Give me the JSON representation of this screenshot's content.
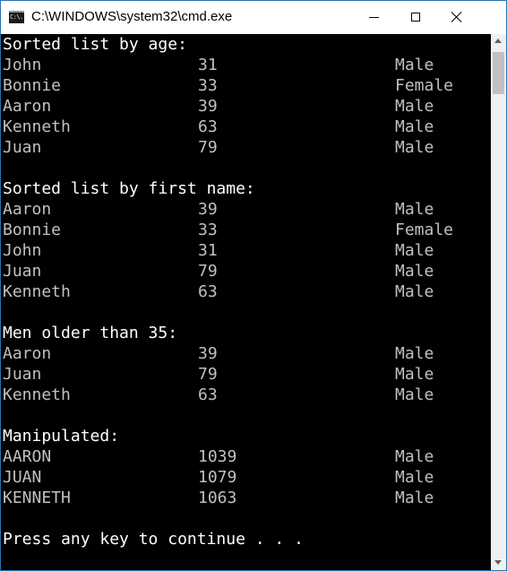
{
  "window": {
    "title": "C:\\WINDOWS\\system32\\cmd.exe",
    "icon": "cmd-icon",
    "icon_text": "C:\\."
  },
  "console": {
    "sections": [
      {
        "header": "Sorted list by age:",
        "rows": [
          {
            "name": "John",
            "age": "31",
            "gender": "Male"
          },
          {
            "name": "Bonnie",
            "age": "33",
            "gender": "Female"
          },
          {
            "name": "Aaron",
            "age": "39",
            "gender": "Male"
          },
          {
            "name": "Kenneth",
            "age": "63",
            "gender": "Male"
          },
          {
            "name": "Juan",
            "age": "79",
            "gender": "Male"
          }
        ]
      },
      {
        "header": "Sorted list by first name:",
        "rows": [
          {
            "name": "Aaron",
            "age": "39",
            "gender": "Male"
          },
          {
            "name": "Bonnie",
            "age": "33",
            "gender": "Female"
          },
          {
            "name": "John",
            "age": "31",
            "gender": "Male"
          },
          {
            "name": "Juan",
            "age": "79",
            "gender": "Male"
          },
          {
            "name": "Kenneth",
            "age": "63",
            "gender": "Male"
          }
        ]
      },
      {
        "header": "Men older than 35:",
        "rows": [
          {
            "name": "Aaron",
            "age": "39",
            "gender": "Male"
          },
          {
            "name": "Juan",
            "age": "79",
            "gender": "Male"
          },
          {
            "name": "Kenneth",
            "age": "63",
            "gender": "Male"
          }
        ]
      },
      {
        "header": "Manipulated:",
        "rows": [
          {
            "name": "AARON",
            "age": "1039",
            "gender": "Male"
          },
          {
            "name": "JUAN",
            "age": "1079",
            "gender": "Male"
          },
          {
            "name": "KENNETH",
            "age": "1063",
            "gender": "Male"
          }
        ]
      }
    ],
    "prompt": "Press any key to continue . . ."
  },
  "colors": {
    "console_background": "#000000",
    "console_text": "#c0c0c0",
    "header_text": "#ffffff",
    "window_border": "#2b6fb3"
  }
}
